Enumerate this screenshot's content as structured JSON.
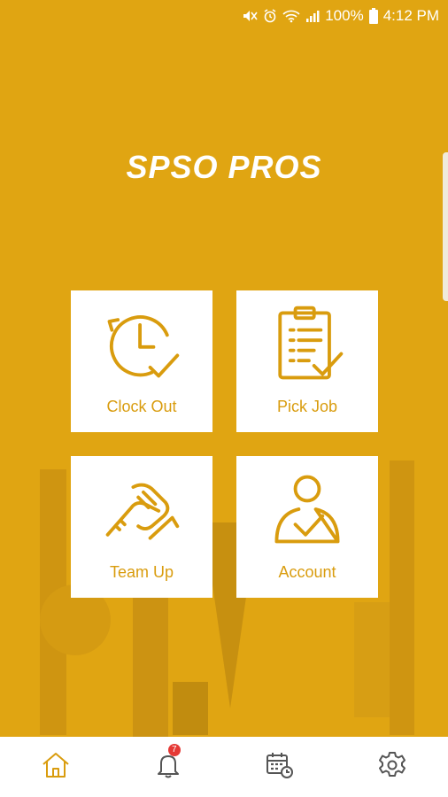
{
  "status_bar": {
    "battery_pct": "100%",
    "time": "4:12 PM",
    "icons": [
      "mute-icon",
      "alarm-icon",
      "wifi-icon",
      "signal-icon",
      "battery-icon"
    ]
  },
  "app": {
    "title": "SPSO PROS",
    "brand_color": "#E0A512",
    "accent_color": "#D99C0E"
  },
  "tiles": [
    {
      "label": "Clock Out",
      "icon": "clock-out-icon"
    },
    {
      "label": "Pick Job",
      "icon": "clipboard-check-icon"
    },
    {
      "label": "Team Up",
      "icon": "handshake-icon"
    },
    {
      "label": "Account",
      "icon": "user-check-icon"
    }
  ],
  "bottom_nav": {
    "items": [
      {
        "icon": "home-icon",
        "active": true
      },
      {
        "icon": "bell-icon",
        "badge": "7"
      },
      {
        "icon": "calendar-clock-icon"
      },
      {
        "icon": "gear-icon"
      }
    ]
  }
}
